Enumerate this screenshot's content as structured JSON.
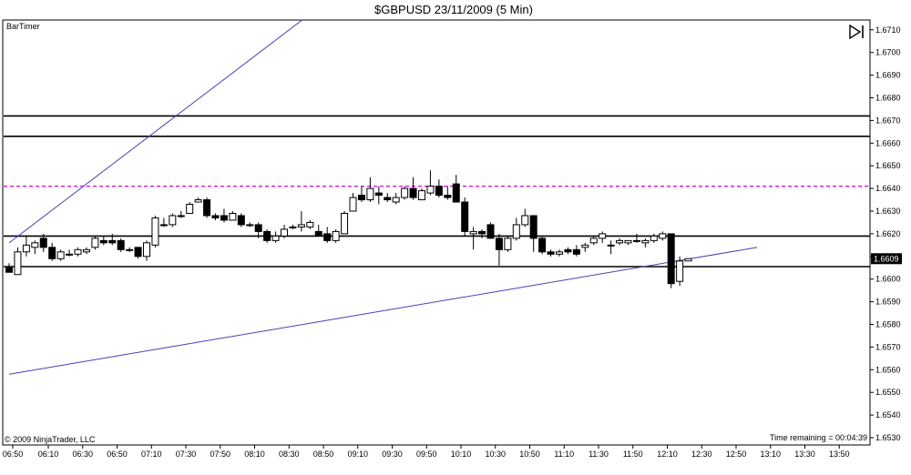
{
  "header": {
    "title": "$GBPUSD  23/11/2009 (5 Min)"
  },
  "indicator_label": "BarTimer",
  "copyright": "© 2009 NinjaTrader, LLC",
  "time_remaining": "Time remaining = 00:04:39",
  "price_tag": "1.6609",
  "play_icon": "skip-to-end-icon",
  "colors": {
    "up": "#ffffff",
    "down": "#000000",
    "trend_line": "#4b3fb5",
    "dashed_line": "#e000e0",
    "price_tag": "#000000"
  },
  "chart_data": {
    "type": "candlestick",
    "title": "$GBPUSD  23/11/2009 (5 Min)",
    "y_ticks": [
      "1.6530",
      "1.6540",
      "1.6550",
      "1.6560",
      "1.6570",
      "1.6580",
      "1.6590",
      "1.6600",
      "1.6610",
      "1.6620",
      "1.6630",
      "1.6640",
      "1.6650",
      "1.6660",
      "1.6670",
      "1.6680",
      "1.6690",
      "1.6700",
      "1.6710"
    ],
    "ylim": [
      1.6526,
      1.672
    ],
    "x_ticks": [
      "06:50",
      "06:10",
      "06:30",
      "06:50",
      "07:10",
      "07:30",
      "07:50",
      "08:10",
      "08:30",
      "08:50",
      "09:10",
      "09:30",
      "09:50",
      "10:10",
      "10:30",
      "10:50",
      "11:10",
      "11:30",
      "11:50",
      "12:10",
      "12:30",
      "12:50",
      "13:10",
      "13:30",
      "13:50"
    ],
    "last_price": 1.6609,
    "horizontal_lines": [
      {
        "price": 1.6672,
        "style": "solid"
      },
      {
        "price": 1.6663,
        "style": "solid"
      },
      {
        "price": 1.6641,
        "style": "dashed"
      },
      {
        "price": 1.6619,
        "style": "solid"
      },
      {
        "price": 1.66055,
        "style": "solid"
      }
    ],
    "trend_lines": [
      {
        "from": [
          "06:45",
          1.6616
        ],
        "to": [
          "09:40",
          1.6717
        ]
      },
      {
        "from": [
          "06:45",
          1.6558
        ],
        "to": [
          "14:00",
          1.6614
        ]
      }
    ],
    "candles": [
      [
        "06:45",
        1.6605,
        1.6607,
        1.6603,
        1.6603
      ],
      [
        "06:50",
        1.6602,
        1.6614,
        1.6602,
        1.6612
      ],
      [
        "06:55",
        1.6612,
        1.6619,
        1.661,
        1.6615
      ],
      [
        "07:00",
        1.6614,
        1.6617,
        1.6611,
        1.6616
      ],
      [
        "07:05",
        1.6618,
        1.662,
        1.6612,
        1.6614
      ],
      [
        "07:10",
        1.6614,
        1.6616,
        1.6608,
        1.6609
      ],
      [
        "07:15",
        1.6609,
        1.6613,
        1.6608,
        1.6612
      ],
      [
        "07:20",
        1.6611,
        1.6613,
        1.661,
        1.6611
      ],
      [
        "07:25",
        1.6611,
        1.6614,
        1.661,
        1.6613
      ],
      [
        "07:30",
        1.6612,
        1.6614,
        1.6611,
        1.6613
      ],
      [
        "07:35",
        1.6614,
        1.6619,
        1.6613,
        1.6618
      ],
      [
        "07:40",
        1.6617,
        1.6619,
        1.6615,
        1.6616
      ],
      [
        "07:45",
        1.6617,
        1.662,
        1.6615,
        1.6616
      ],
      [
        "07:50",
        1.6617,
        1.6618,
        1.6612,
        1.6613
      ],
      [
        "07:55",
        1.6613,
        1.6614,
        1.6612,
        1.6613
      ],
      [
        "08:00",
        1.6614,
        1.6614,
        1.6609,
        1.661
      ],
      [
        "08:05",
        1.661,
        1.6617,
        1.6608,
        1.6616
      ],
      [
        "08:10",
        1.6615,
        1.6628,
        1.6614,
        1.6627
      ],
      [
        "08:15",
        1.6624,
        1.6627,
        1.6623,
        1.6624
      ],
      [
        "08:20",
        1.6624,
        1.6629,
        1.6623,
        1.6628
      ],
      [
        "08:25",
        1.6628,
        1.663,
        1.6627,
        1.6628
      ],
      [
        "08:30",
        1.6629,
        1.6634,
        1.6629,
        1.6633
      ],
      [
        "08:35",
        1.6634,
        1.6636,
        1.6634,
        1.6635
      ],
      [
        "08:40",
        1.6635,
        1.6636,
        1.6627,
        1.6628
      ],
      [
        "08:45",
        1.6628,
        1.6629,
        1.6626,
        1.6627
      ],
      [
        "08:50",
        1.6628,
        1.6631,
        1.6625,
        1.6626
      ],
      [
        "08:55",
        1.6626,
        1.663,
        1.6628,
        1.6629
      ],
      [
        "09:00",
        1.6628,
        1.6629,
        1.6623,
        1.6624
      ],
      [
        "09:05",
        1.6624,
        1.6625,
        1.6623,
        1.6624
      ],
      [
        "09:10",
        1.6624,
        1.6625,
        1.6618,
        1.6621
      ],
      [
        "09:15",
        1.6621,
        1.6622,
        1.6616,
        1.6617
      ],
      [
        "09:20",
        1.6617,
        1.6621,
        1.6616,
        1.6619
      ],
      [
        "09:25",
        1.6619,
        1.6624,
        1.6618,
        1.6622
      ],
      [
        "09:30",
        1.6623,
        1.6624,
        1.6622,
        1.6623
      ],
      [
        "09:35",
        1.6623,
        1.663,
        1.6621,
        1.6624
      ],
      [
        "09:40",
        1.6623,
        1.6626,
        1.6622,
        1.6625
      ],
      [
        "09:45",
        1.6621,
        1.6624,
        1.6619,
        1.6619
      ],
      [
        "09:50",
        1.662,
        1.6623,
        1.6616,
        1.6617
      ],
      [
        "09:55",
        1.6617,
        1.6622,
        1.6616,
        1.6621
      ],
      [
        "10:00",
        1.662,
        1.663,
        1.662,
        1.6629
      ],
      [
        "10:05",
        1.663,
        1.6638,
        1.663,
        1.6636
      ],
      [
        "10:10",
        1.6637,
        1.6641,
        1.6634,
        1.6635
      ],
      [
        "10:15",
        1.6635,
        1.6645,
        1.6634,
        1.664
      ],
      [
        "10:20",
        1.6638,
        1.6641,
        1.6633,
        1.6637
      ],
      [
        "10:25",
        1.6636,
        1.6638,
        1.6634,
        1.6635
      ],
      [
        "10:30",
        1.6634,
        1.6638,
        1.6633,
        1.6636
      ],
      [
        "10:35",
        1.6636,
        1.6641,
        1.6635,
        1.664
      ],
      [
        "10:40",
        1.664,
        1.6645,
        1.6635,
        1.6636
      ],
      [
        "10:45",
        1.6635,
        1.664,
        1.6635,
        1.6639
      ],
      [
        "10:50",
        1.6638,
        1.6648,
        1.6637,
        1.6641
      ],
      [
        "10:55",
        1.6641,
        1.6644,
        1.6636,
        1.6637
      ],
      [
        "11:00",
        1.6637,
        1.6641,
        1.6635,
        1.6636
      ],
      [
        "11:05",
        1.6642,
        1.6646,
        1.6634,
        1.6634
      ],
      [
        "11:10",
        1.6634,
        1.6636,
        1.6619,
        1.6621
      ],
      [
        "11:15",
        1.662,
        1.6623,
        1.6613,
        1.6621
      ],
      [
        "11:20",
        1.6621,
        1.6622,
        1.6618,
        1.662
      ],
      [
        "11:25",
        1.6624,
        1.6625,
        1.6618,
        1.6618
      ],
      [
        "11:30",
        1.6618,
        1.662,
        1.6606,
        1.6613
      ],
      [
        "11:35",
        1.6613,
        1.6619,
        1.6612,
        1.6618
      ],
      [
        "11:40",
        1.6618,
        1.6627,
        1.6617,
        1.6624
      ],
      [
        "11:45",
        1.6624,
        1.6631,
        1.6623,
        1.6628
      ],
      [
        "11:50",
        1.6628,
        1.6628,
        1.6612,
        1.6618
      ],
      [
        "11:55",
        1.6618,
        1.6619,
        1.6611,
        1.6612
      ],
      [
        "12:00",
        1.6612,
        1.6613,
        1.661,
        1.6611
      ],
      [
        "12:05",
        1.6611,
        1.6613,
        1.661,
        1.6612
      ],
      [
        "12:10",
        1.6613,
        1.6614,
        1.6611,
        1.6612
      ],
      [
        "12:15",
        1.6613,
        1.6615,
        1.661,
        1.6611
      ],
      [
        "12:20",
        1.6614,
        1.6616,
        1.6612,
        1.6615
      ],
      [
        "12:25",
        1.6616,
        1.6619,
        1.6615,
        1.6618
      ],
      [
        "12:30",
        1.6618,
        1.6621,
        1.6616,
        1.662
      ],
      [
        "12:35",
        1.6615,
        1.6617,
        1.6611,
        1.6615
      ],
      [
        "12:40",
        1.6616,
        1.6618,
        1.6615,
        1.6617
      ],
      [
        "12:45",
        1.6616,
        1.6617,
        1.6615,
        1.6617
      ],
      [
        "12:50",
        1.6617,
        1.662,
        1.6616,
        1.6617
      ],
      [
        "12:55",
        1.6616,
        1.6618,
        1.6614,
        1.6617
      ],
      [
        "13:00",
        1.6617,
        1.662,
        1.6616,
        1.6619
      ],
      [
        "13:05",
        1.6618,
        1.6621,
        1.6617,
        1.662
      ],
      [
        "13:10",
        1.662,
        1.662,
        1.6596,
        1.6598
      ],
      [
        "13:15",
        1.6599,
        1.661,
        1.6597,
        1.6608
      ],
      [
        "13:20",
        1.6608,
        1.6609,
        1.6608,
        1.6609
      ]
    ]
  }
}
